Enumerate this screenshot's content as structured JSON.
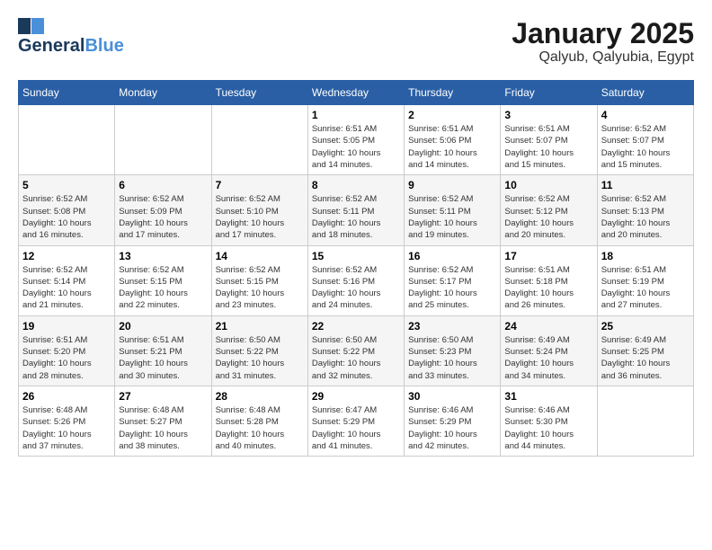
{
  "header": {
    "logo_line1": "General",
    "logo_line2": "Blue",
    "title": "January 2025",
    "subtitle": "Qalyub, Qalyubia, Egypt"
  },
  "days_of_week": [
    "Sunday",
    "Monday",
    "Tuesday",
    "Wednesday",
    "Thursday",
    "Friday",
    "Saturday"
  ],
  "weeks": [
    [
      {
        "day": "",
        "info": ""
      },
      {
        "day": "",
        "info": ""
      },
      {
        "day": "",
        "info": ""
      },
      {
        "day": "1",
        "info": "Sunrise: 6:51 AM\nSunset: 5:05 PM\nDaylight: 10 hours\nand 14 minutes."
      },
      {
        "day": "2",
        "info": "Sunrise: 6:51 AM\nSunset: 5:06 PM\nDaylight: 10 hours\nand 14 minutes."
      },
      {
        "day": "3",
        "info": "Sunrise: 6:51 AM\nSunset: 5:07 PM\nDaylight: 10 hours\nand 15 minutes."
      },
      {
        "day": "4",
        "info": "Sunrise: 6:52 AM\nSunset: 5:07 PM\nDaylight: 10 hours\nand 15 minutes."
      }
    ],
    [
      {
        "day": "5",
        "info": "Sunrise: 6:52 AM\nSunset: 5:08 PM\nDaylight: 10 hours\nand 16 minutes."
      },
      {
        "day": "6",
        "info": "Sunrise: 6:52 AM\nSunset: 5:09 PM\nDaylight: 10 hours\nand 17 minutes."
      },
      {
        "day": "7",
        "info": "Sunrise: 6:52 AM\nSunset: 5:10 PM\nDaylight: 10 hours\nand 17 minutes."
      },
      {
        "day": "8",
        "info": "Sunrise: 6:52 AM\nSunset: 5:11 PM\nDaylight: 10 hours\nand 18 minutes."
      },
      {
        "day": "9",
        "info": "Sunrise: 6:52 AM\nSunset: 5:11 PM\nDaylight: 10 hours\nand 19 minutes."
      },
      {
        "day": "10",
        "info": "Sunrise: 6:52 AM\nSunset: 5:12 PM\nDaylight: 10 hours\nand 20 minutes."
      },
      {
        "day": "11",
        "info": "Sunrise: 6:52 AM\nSunset: 5:13 PM\nDaylight: 10 hours\nand 20 minutes."
      }
    ],
    [
      {
        "day": "12",
        "info": "Sunrise: 6:52 AM\nSunset: 5:14 PM\nDaylight: 10 hours\nand 21 minutes."
      },
      {
        "day": "13",
        "info": "Sunrise: 6:52 AM\nSunset: 5:15 PM\nDaylight: 10 hours\nand 22 minutes."
      },
      {
        "day": "14",
        "info": "Sunrise: 6:52 AM\nSunset: 5:15 PM\nDaylight: 10 hours\nand 23 minutes."
      },
      {
        "day": "15",
        "info": "Sunrise: 6:52 AM\nSunset: 5:16 PM\nDaylight: 10 hours\nand 24 minutes."
      },
      {
        "day": "16",
        "info": "Sunrise: 6:52 AM\nSunset: 5:17 PM\nDaylight: 10 hours\nand 25 minutes."
      },
      {
        "day": "17",
        "info": "Sunrise: 6:51 AM\nSunset: 5:18 PM\nDaylight: 10 hours\nand 26 minutes."
      },
      {
        "day": "18",
        "info": "Sunrise: 6:51 AM\nSunset: 5:19 PM\nDaylight: 10 hours\nand 27 minutes."
      }
    ],
    [
      {
        "day": "19",
        "info": "Sunrise: 6:51 AM\nSunset: 5:20 PM\nDaylight: 10 hours\nand 28 minutes."
      },
      {
        "day": "20",
        "info": "Sunrise: 6:51 AM\nSunset: 5:21 PM\nDaylight: 10 hours\nand 30 minutes."
      },
      {
        "day": "21",
        "info": "Sunrise: 6:50 AM\nSunset: 5:22 PM\nDaylight: 10 hours\nand 31 minutes."
      },
      {
        "day": "22",
        "info": "Sunrise: 6:50 AM\nSunset: 5:22 PM\nDaylight: 10 hours\nand 32 minutes."
      },
      {
        "day": "23",
        "info": "Sunrise: 6:50 AM\nSunset: 5:23 PM\nDaylight: 10 hours\nand 33 minutes."
      },
      {
        "day": "24",
        "info": "Sunrise: 6:49 AM\nSunset: 5:24 PM\nDaylight: 10 hours\nand 34 minutes."
      },
      {
        "day": "25",
        "info": "Sunrise: 6:49 AM\nSunset: 5:25 PM\nDaylight: 10 hours\nand 36 minutes."
      }
    ],
    [
      {
        "day": "26",
        "info": "Sunrise: 6:48 AM\nSunset: 5:26 PM\nDaylight: 10 hours\nand 37 minutes."
      },
      {
        "day": "27",
        "info": "Sunrise: 6:48 AM\nSunset: 5:27 PM\nDaylight: 10 hours\nand 38 minutes."
      },
      {
        "day": "28",
        "info": "Sunrise: 6:48 AM\nSunset: 5:28 PM\nDaylight: 10 hours\nand 40 minutes."
      },
      {
        "day": "29",
        "info": "Sunrise: 6:47 AM\nSunset: 5:29 PM\nDaylight: 10 hours\nand 41 minutes."
      },
      {
        "day": "30",
        "info": "Sunrise: 6:46 AM\nSunset: 5:29 PM\nDaylight: 10 hours\nand 42 minutes."
      },
      {
        "day": "31",
        "info": "Sunrise: 6:46 AM\nSunset: 5:30 PM\nDaylight: 10 hours\nand 44 minutes."
      },
      {
        "day": "",
        "info": ""
      }
    ]
  ]
}
